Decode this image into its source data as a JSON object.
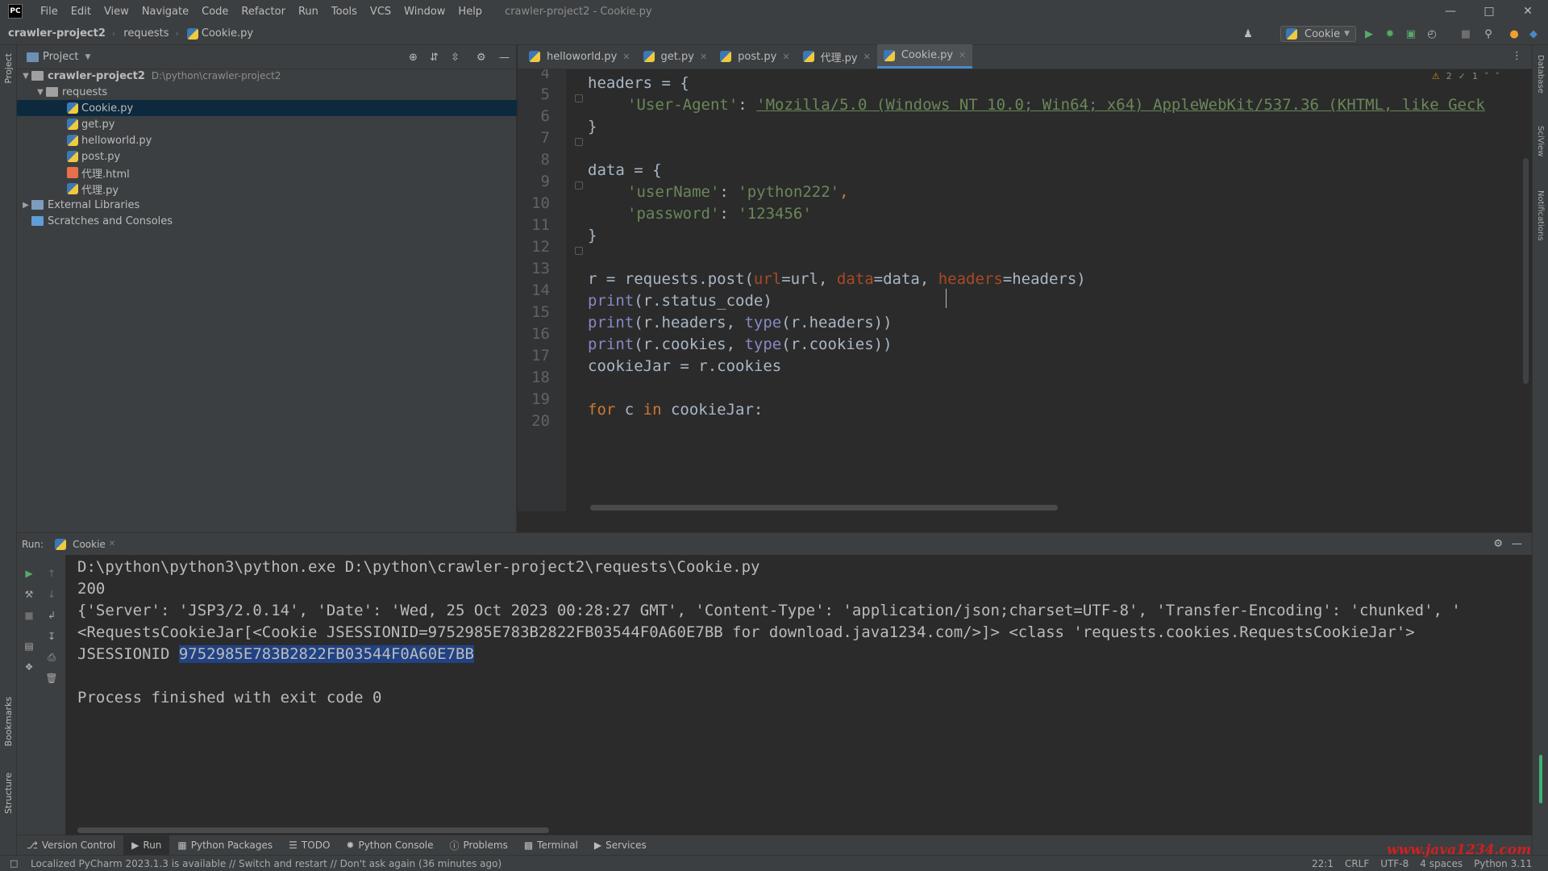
{
  "titlebar": {
    "logo": "PC",
    "menu": [
      "File",
      "Edit",
      "View",
      "Navigate",
      "Code",
      "Refactor",
      "Run",
      "Tools",
      "VCS",
      "Window",
      "Help"
    ],
    "title": "crawler-project2 - Cookie.py"
  },
  "navbar": {
    "breadcrumbs": [
      "crawler-project2",
      "requests",
      "Cookie.py"
    ],
    "run_config": "Cookie"
  },
  "left_stripe": {
    "project": "Project",
    "bookmarks": "Bookmarks",
    "structure": "Structure"
  },
  "right_stripe": {
    "database": "Database",
    "sciview": "SciView",
    "notifications": "Notifications"
  },
  "project": {
    "header": "Project",
    "tree": [
      {
        "label": "crawler-project2",
        "path": "D:\\python\\crawler-project2",
        "type": "root"
      },
      {
        "label": "requests",
        "type": "folder"
      },
      {
        "label": "Cookie.py",
        "type": "py",
        "selected": true
      },
      {
        "label": "get.py",
        "type": "py"
      },
      {
        "label": "helloworld.py",
        "type": "py"
      },
      {
        "label": "post.py",
        "type": "py"
      },
      {
        "label": "代理.html",
        "type": "html"
      },
      {
        "label": "代理.py",
        "type": "py"
      },
      {
        "label": "External Libraries",
        "type": "lib"
      },
      {
        "label": "Scratches and Consoles",
        "type": "scratch"
      }
    ]
  },
  "editor": {
    "tabs": [
      "helloworld.py",
      "get.py",
      "post.py",
      "代理.py",
      "Cookie.py"
    ],
    "active_tab": "Cookie.py",
    "inspections": {
      "warnings": "2",
      "ok": "1"
    },
    "line_numbers": [
      "4",
      "5",
      "6",
      "7",
      "8",
      "9",
      "10",
      "11",
      "12",
      "13",
      "14",
      "15",
      "16",
      "17",
      "18",
      "19",
      "20"
    ],
    "lines": {
      "l5": "headers = {",
      "l6_key": "'User-Agent'",
      "l6_val": "'Mozilla/5.0 (Windows NT 10.0; Win64; x64) AppleWebKit/537.36 (KHTML, like Geck",
      "l7": "}",
      "l9": "data = {",
      "l10_key": "'userName'",
      "l10_val": "'python222'",
      "l11_key": "'password'",
      "l11_val": "'123456'",
      "l12": "}",
      "l14_a": "r = requests.post(",
      "l14_url": "url",
      "l14_b": "=url, ",
      "l14_data": "data",
      "l14_c": "=data, ",
      "l14_headers": "headers",
      "l14_d": "=headers)",
      "l15_fn": "print",
      "l15_rest": "(r.status_code)",
      "l16_fn": "print",
      "l16_a": "(r.headers, ",
      "l16_type": "type",
      "l16_b": "(r.headers))",
      "l17_fn": "print",
      "l17_a": "(r.cookies, ",
      "l17_type": "type",
      "l17_b": "(r.cookies))",
      "l18": "cookieJar = r.cookies",
      "l20_for": "for",
      "l20_c": " c ",
      "l20_in": "in",
      "l20_rest": " cookieJar:"
    }
  },
  "run": {
    "label": "Run:",
    "tab": "Cookie",
    "output": [
      "D:\\python\\python3\\python.exe D:\\python\\crawler-project2\\requests\\Cookie.py",
      "200",
      "{'Server': 'JSP3/2.0.14', 'Date': 'Wed, 25 Oct 2023 00:28:27 GMT', 'Content-Type': 'application/json;charset=UTF-8', 'Transfer-Encoding': 'chunked', '",
      "<RequestsCookieJar[<Cookie JSESSIONID=9752985E783B2822FB03544F0A60E7BB for download.java1234.com/>]> <class 'requests.cookies.RequestsCookieJar'>",
      "",
      "Process finished with exit code 0"
    ],
    "session_label": "JSESSIONID ",
    "session_value": "9752985E783B2822FB03544F0A60E7BB"
  },
  "tool_tabs": [
    "Version Control",
    "Run",
    "Python Packages",
    "TODO",
    "Python Console",
    "Problems",
    "Terminal",
    "Services"
  ],
  "status": {
    "message": "Localized PyCharm 2023.1.3 is available // Switch and restart // Don't ask again (36 minutes ago)",
    "position": "22:1",
    "line_sep": "CRLF",
    "encoding": "UTF-8",
    "indent": "4 spaces",
    "interpreter": "Python 3.11"
  },
  "watermark": "www.java1234.com",
  "colors": {
    "keyword": "#cc7832",
    "string": "#6a8759",
    "builtin": "#8888c6",
    "param": "#aa4926",
    "selection": "#214283"
  }
}
